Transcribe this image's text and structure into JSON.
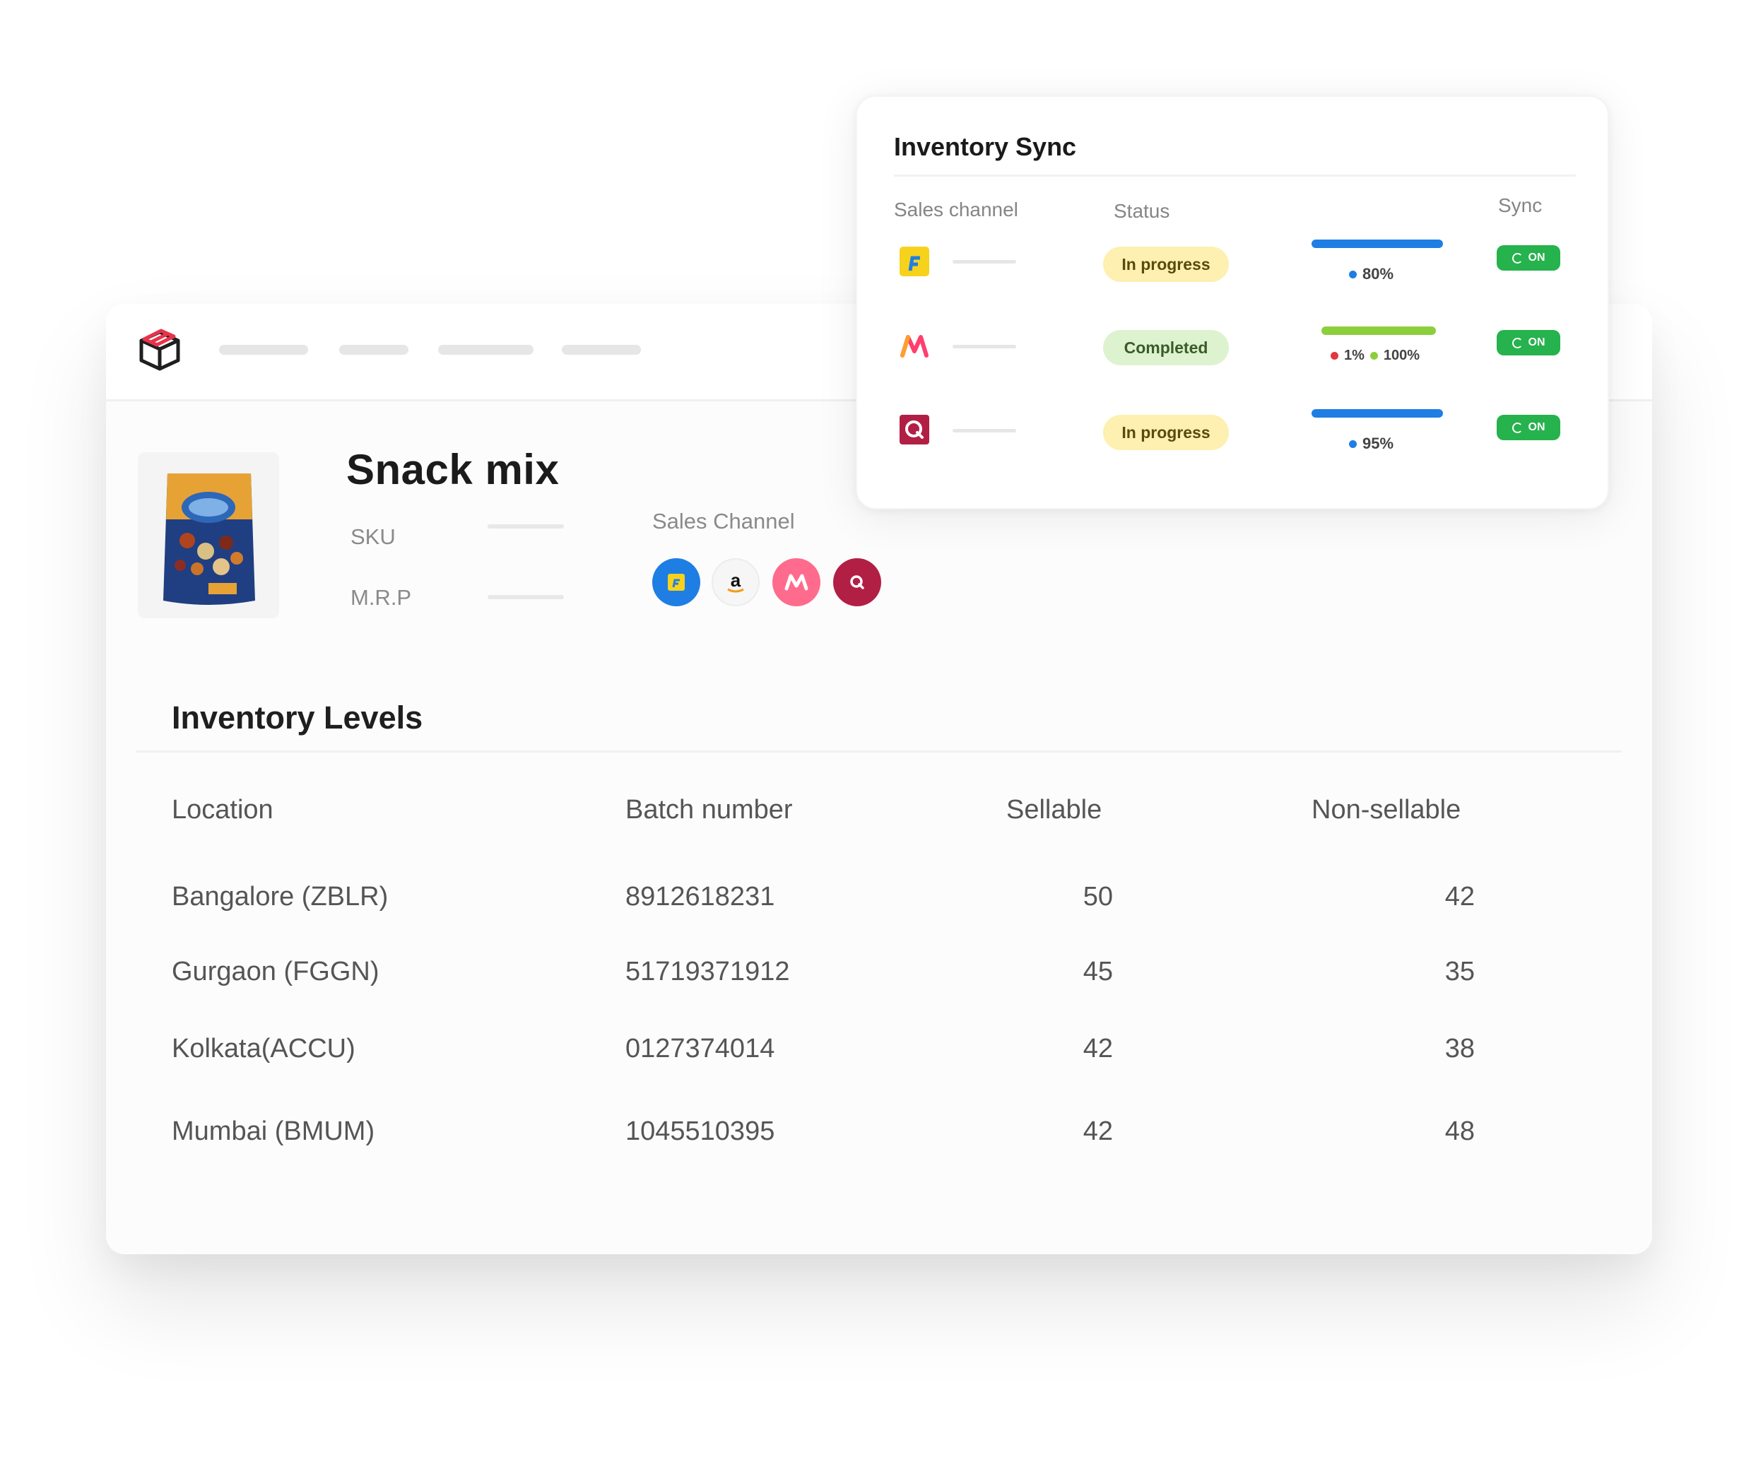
{
  "header": {
    "nav_placeholders": 4
  },
  "product": {
    "title": "Snack mix",
    "sku_label": "SKU",
    "mrp_label": "M.R.P",
    "sales_channel_label": "Sales Channel",
    "channels": [
      {
        "icon": "flipkart-icon",
        "color": "#1e7ee4"
      },
      {
        "icon": "amazon-icon",
        "color": "#f6f6f6",
        "glyph": "a"
      },
      {
        "icon": "myntra-icon",
        "color": "#ff6b8c"
      },
      {
        "icon": "qoo10-icon",
        "color": "#b21f45"
      }
    ]
  },
  "inventory": {
    "title": "Inventory Levels",
    "columns": [
      "Location",
      "Batch number",
      "Sellable",
      "Non-sellable"
    ],
    "rows": [
      {
        "location": "Bangalore (ZBLR)",
        "batch": "8912618231",
        "sellable": "50",
        "non_sellable": "42"
      },
      {
        "location": "Gurgaon (FGGN)",
        "batch": "51719371912",
        "sellable": "45",
        "non_sellable": "35"
      },
      {
        "location": "Kolkata(ACCU)",
        "batch": "0127374014",
        "sellable": "42",
        "non_sellable": "38"
      },
      {
        "location": "Mumbai (BMUM)",
        "batch": "1045510395",
        "sellable": "42",
        "non_sellable": "48"
      }
    ]
  },
  "sync": {
    "title": "Inventory Sync",
    "headers": {
      "channel": "Sales channel",
      "status": "Status",
      "sync": "Sync"
    },
    "rows": [
      {
        "icon": "flipkart-icon",
        "status": "In progress",
        "progress_label": "80%",
        "progress": 0.8,
        "toggle": "ON"
      },
      {
        "icon": "myntra-icon",
        "status": "Completed",
        "progress_label_a": "1%",
        "progress_label_b": "100%",
        "progress": 1.0,
        "toggle": "ON"
      },
      {
        "icon": "qoo10-icon",
        "status": "In progress",
        "progress_label": "95%",
        "progress": 0.95,
        "toggle": "ON"
      }
    ],
    "colors": {
      "bar_blue": "#1e7ee4",
      "bar_green": "#8ccf3c",
      "toggle_green": "#26b24d",
      "dot_red": "#e0383e"
    }
  }
}
